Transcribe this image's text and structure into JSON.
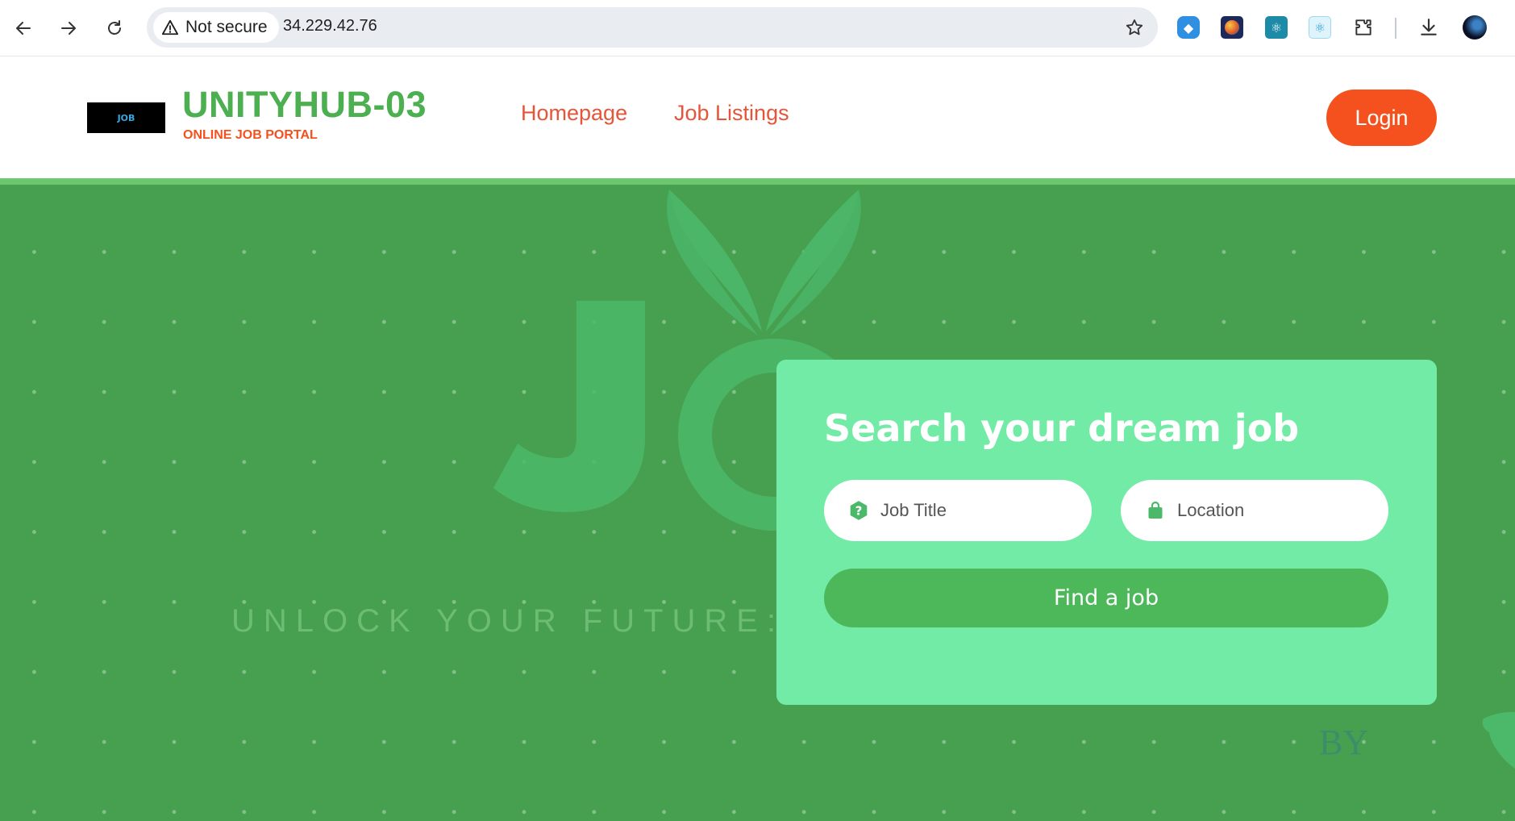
{
  "browser": {
    "security_label": "Not secure",
    "url": "34.229.42.76",
    "extensions": [
      "bing-icon",
      "globe-extension-icon",
      "react-devtools-icon",
      "react-extension-icon",
      "puzzle-icon"
    ]
  },
  "site": {
    "logo_text": "JOB",
    "brand_title": "UNITYHUB-03",
    "brand_subtitle": "ONLINE JOB PORTAL",
    "nav": [
      {
        "label": "Homepage"
      },
      {
        "label": "Job Listings"
      }
    ],
    "login_label": "Login"
  },
  "hero": {
    "tagline": "UNLOCK YOUR FUTURE: DIS",
    "by_text": "BY",
    "colors": {
      "background": "#46a050",
      "card": "#72eba7",
      "accent": "#f4511e",
      "brand": "#4caf50"
    }
  },
  "search": {
    "title": "Search your dream job",
    "job_title_placeholder": "Job Title",
    "location_placeholder": "Location",
    "submit_label": "Find a job"
  }
}
